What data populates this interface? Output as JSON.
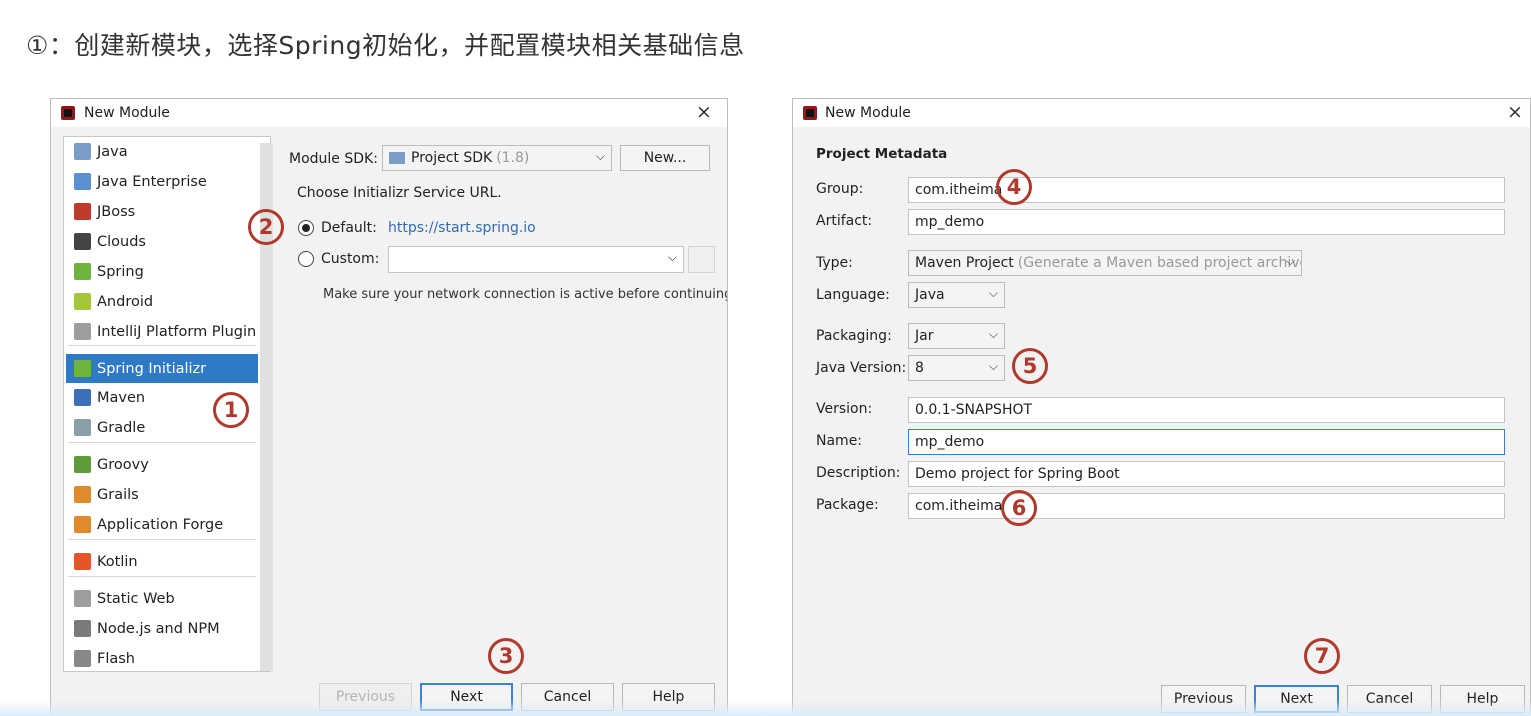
{
  "heading": "①：创建新模块，选择Spring初始化，并配置模块相关基础信息",
  "badges": [
    "1",
    "2",
    "3",
    "4",
    "5",
    "6",
    "7"
  ],
  "dialog_left": {
    "title": "New Module",
    "close": "×",
    "modules": [
      {
        "label": "Java",
        "icon": "java-folder-icon",
        "color": "#7a9cc6"
      },
      {
        "label": "Java Enterprise",
        "icon": "java-enterprise-icon",
        "color": "#5a8fd0"
      },
      {
        "label": "JBoss",
        "icon": "jboss-icon",
        "color": "#c0392b"
      },
      {
        "label": "Clouds",
        "icon": "clouds-icon",
        "color": "#444444"
      },
      {
        "label": "Spring",
        "icon": "spring-leaf-icon",
        "color": "#6db33f"
      },
      {
        "label": "Android",
        "icon": "android-icon",
        "color": "#a4c639"
      },
      {
        "label": "IntelliJ Platform Plugin",
        "icon": "intellij-plugin-icon",
        "color": "#9e9e9e"
      },
      {
        "label": "Spring Initializr",
        "icon": "spring-initializr-icon",
        "color": "#6db33f"
      },
      {
        "label": "Maven",
        "icon": "maven-icon",
        "color": "#3b6fb6"
      },
      {
        "label": "Gradle",
        "icon": "gradle-icon",
        "color": "#8aa0a8"
      },
      {
        "label": "Groovy",
        "icon": "groovy-icon",
        "color": "#5e9b3a"
      },
      {
        "label": "Grails",
        "icon": "grails-icon",
        "color": "#e08a2e"
      },
      {
        "label": "Application Forge",
        "icon": "application-forge-icon",
        "color": "#e08a2e"
      },
      {
        "label": "Kotlin",
        "icon": "kotlin-icon",
        "color": "#e7542a"
      },
      {
        "label": "Static Web",
        "icon": "static-web-icon",
        "color": "#9e9e9e"
      },
      {
        "label": "Node.js and NPM",
        "icon": "nodejs-icon",
        "color": "#7a7a7a"
      },
      {
        "label": "Flash",
        "icon": "flash-icon",
        "color": "#888888"
      }
    ],
    "selected_module": "Spring Initializr",
    "sdk_label": "Module SDK:",
    "sdk_value": "Project SDK",
    "sdk_version": "(1.8)",
    "new_button": "New...",
    "choose_url": "Choose Initializr Service URL.",
    "default_label": "Default:",
    "default_url": "https://start.spring.io",
    "custom_label": "Custom:",
    "network_note": "Make sure your network connection is active before continuing.",
    "buttons": {
      "previous": "Previous",
      "next": "Next",
      "cancel": "Cancel",
      "help": "Help"
    }
  },
  "dialog_right": {
    "title": "New Module",
    "close": "×",
    "section": "Project Metadata",
    "group_label": "Group:",
    "group_value": "com.itheima",
    "artifact_label": "Artifact:",
    "artifact_value": "mp_demo",
    "type_label": "Type:",
    "type_value": "Maven Project",
    "type_hint": "(Generate a Maven based project archive.)",
    "language_label": "Language:",
    "language_value": "Java",
    "packaging_label": "Packaging:",
    "packaging_value": "Jar",
    "java_version_label": "Java Version:",
    "java_version_value": "8",
    "version_label": "Version:",
    "version_value": "0.0.1-SNAPSHOT",
    "name_label": "Name:",
    "name_value": "mp_demo",
    "description_label": "Description:",
    "description_value": "Demo project for Spring Boot",
    "package_label": "Package:",
    "package_value": "com.itheima",
    "buttons": {
      "previous": "Previous",
      "next": "Next",
      "cancel": "Cancel",
      "help": "Help"
    }
  }
}
